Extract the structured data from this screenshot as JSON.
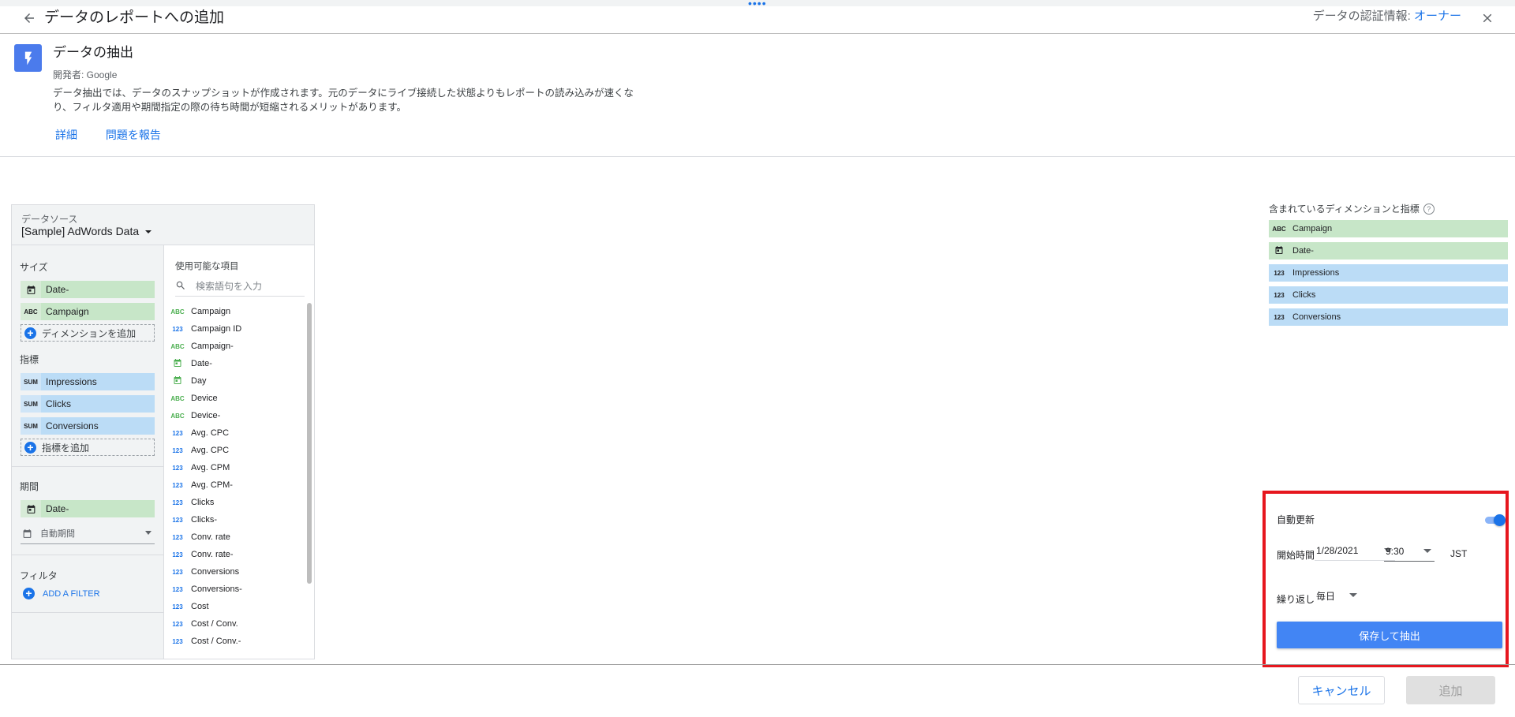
{
  "header": {
    "title": "データのレポートへの追加",
    "credentials_label": "データの認証情報:",
    "credentials_value": "オーナー"
  },
  "connector": {
    "title": "データの抽出",
    "developer": "開発者: Google",
    "description_line1": "データ抽出では、データのスナップショットが作成されます。元のデータにライブ接続した状態よりもレポートの読み込みが速くな",
    "description_line2": "り、フィルタ適用や期間指定の際の待ち時間が短縮されるメリットがあります。",
    "link_details": "詳細",
    "link_report": "問題を報告"
  },
  "datasource": {
    "label": "データソース",
    "name": "[Sample] AdWords Data"
  },
  "config": {
    "dimensions_title": "サイズ",
    "dimensions": [
      {
        "icon": "calendar-icon",
        "label": "Date-"
      },
      {
        "icon": "text-type-icon",
        "type": "ABC",
        "label": "Campaign"
      }
    ],
    "add_dimension": "ディメンションを追加",
    "metrics_title": "指標",
    "metrics": [
      {
        "type": "SUM",
        "label": "Impressions"
      },
      {
        "type": "SUM",
        "label": "Clicks"
      },
      {
        "type": "SUM",
        "label": "Conversions"
      }
    ],
    "add_metric": "指標を追加",
    "period_title": "期間",
    "period_dimension": "Date-",
    "period_select": "自動期間",
    "filter_title": "フィルタ",
    "add_filter": "ADD A FILTER"
  },
  "available": {
    "title": "使用可能な項目",
    "search_placeholder": "検索語句を入力",
    "fields": [
      {
        "type": "ABC",
        "label": "Campaign"
      },
      {
        "type": "123",
        "label": "Campaign ID"
      },
      {
        "type": "ABC",
        "label": "Campaign-"
      },
      {
        "type": "date",
        "label": "Date-"
      },
      {
        "type": "date",
        "label": "Day"
      },
      {
        "type": "ABC",
        "label": "Device"
      },
      {
        "type": "ABC",
        "label": "Device-"
      },
      {
        "type": "123",
        "label": "Avg. CPC"
      },
      {
        "type": "123",
        "label": "Avg. CPC"
      },
      {
        "type": "123",
        "label": "Avg. CPM"
      },
      {
        "type": "123",
        "label": "Avg. CPM-"
      },
      {
        "type": "123",
        "label": "Clicks"
      },
      {
        "type": "123",
        "label": "Clicks-"
      },
      {
        "type": "123",
        "label": "Conv. rate"
      },
      {
        "type": "123",
        "label": "Conv. rate-"
      },
      {
        "type": "123",
        "label": "Conversions"
      },
      {
        "type": "123",
        "label": "Conversions-"
      },
      {
        "type": "123",
        "label": "Cost"
      },
      {
        "type": "123",
        "label": "Cost / Conv."
      },
      {
        "type": "123",
        "label": "Cost / Conv.-"
      }
    ]
  },
  "included": {
    "title": "含まれているディメンションと指標",
    "items": [
      {
        "kind": "dim",
        "type": "ABC",
        "label": "Campaign"
      },
      {
        "kind": "dim",
        "type": "date",
        "label": "Date-"
      },
      {
        "kind": "met",
        "type": "123",
        "label": "Impressions"
      },
      {
        "kind": "met",
        "type": "123",
        "label": "Clicks"
      },
      {
        "kind": "met",
        "type": "123",
        "label": "Conversions"
      }
    ]
  },
  "refresh": {
    "auto_label": "自動更新",
    "auto_enabled": true,
    "start_label": "開始時間",
    "start_date": "1/28/2021",
    "start_time": "9:30",
    "timezone": "JST",
    "repeat_label": "繰り返し",
    "repeat_value": "毎日",
    "save_button": "保存して抽出"
  },
  "footer": {
    "cancel": "キャンセル",
    "add": "追加"
  },
  "colors": {
    "accent": "#1a73e8",
    "highlight_box": "#e6161e",
    "dimension_chip": "#c7e6c8",
    "metric_chip": "#bbdcf6"
  }
}
